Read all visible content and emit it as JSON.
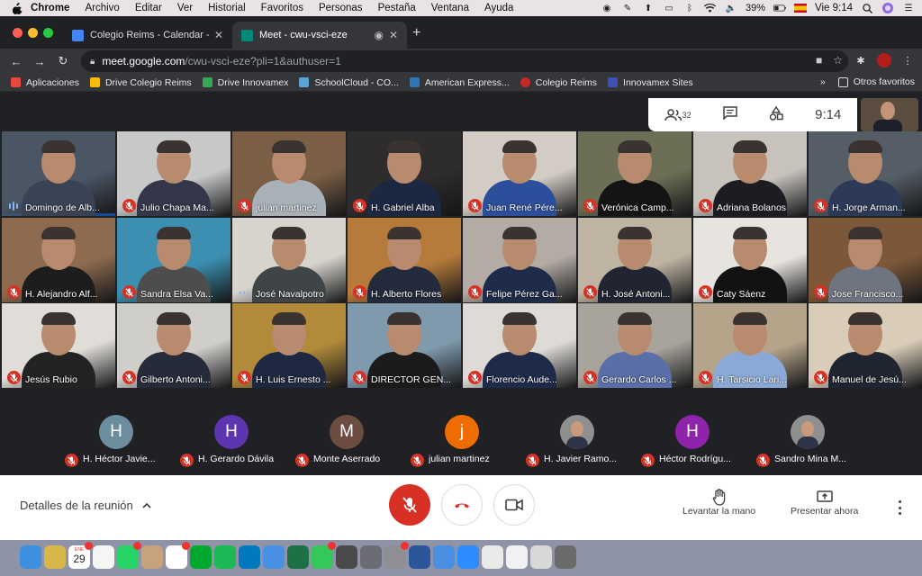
{
  "menubar": {
    "app": "Chrome",
    "items": [
      "Archivo",
      "Editar",
      "Ver",
      "Historial",
      "Favoritos",
      "Personas",
      "Pestaña",
      "Ventana",
      "Ayuda"
    ],
    "battery": "39%",
    "clock": "Vie 9:14"
  },
  "tabs": [
    {
      "title": "Colegio Reims - Calendar - vie",
      "active": false,
      "favicon_color": "#4285f4"
    },
    {
      "title": "Meet - cwu-vsci-eze",
      "active": true,
      "favicon_color": "#00897b"
    }
  ],
  "address": {
    "host": "meet.google.com",
    "path": "/cwu-vsci-eze?pli=1&authuser=1"
  },
  "bookmarks": {
    "items": [
      {
        "label": "Aplicaciones",
        "icon": "apps-grid-icon",
        "color": "#e8453c"
      },
      {
        "label": "Drive Colegio Reims",
        "icon": "drive-icon",
        "color": "#fbbc04"
      },
      {
        "label": "Drive Innovamex",
        "icon": "drive-icon",
        "color": "#34a853"
      },
      {
        "label": "SchoolCloud - CO...",
        "icon": "schoolcloud-icon",
        "color": "#58a6d8"
      },
      {
        "label": "American Express...",
        "icon": "amex-icon",
        "color": "#2e77bb"
      },
      {
        "label": "Colegio Reims",
        "icon": "reims-icon",
        "color": "#c62828"
      },
      {
        "label": "Innovamex Sites",
        "icon": "sites-icon",
        "color": "#3f51b5"
      }
    ],
    "overflow": "»",
    "other": "Otros favoritos"
  },
  "meeting": {
    "participant_count": "32",
    "time": "9:14",
    "grid": [
      {
        "name": "Domingo de Alb...",
        "muted": false,
        "speaking": true,
        "bg": "#4b5665",
        "shirt": "#3a4255"
      },
      {
        "name": "Julio Chapa Ma...",
        "muted": true,
        "bg": "#c7c9c9",
        "shirt": "#34364a"
      },
      {
        "name": "julian martinez",
        "muted": true,
        "bg": "#7a5f45",
        "shirt": "#a8b0b8"
      },
      {
        "name": "H. Gabriel Alba",
        "muted": true,
        "bg": "#2e2c2c",
        "shirt": "#1c2742"
      },
      {
        "name": "Juan René Pére...",
        "muted": true,
        "bg": "#d3ccc4",
        "shirt": "#2b4f9a"
      },
      {
        "name": "Verónica Camp...",
        "muted": true,
        "bg": "#6c6f56",
        "shirt": "#141414"
      },
      {
        "name": "Adriana Bolanos",
        "muted": true,
        "bg": "#c7c2bc",
        "shirt": "#1b1d23"
      },
      {
        "name": "H. Jorge Arman...",
        "muted": true,
        "bg": "#555e66",
        "shirt": "#2c3a58"
      },
      {
        "name": "H. Alejandro Alf...",
        "muted": true,
        "bg": "#8e6b4f",
        "shirt": "#1d1d1d"
      },
      {
        "name": "Sandra Elsa Va...",
        "muted": true,
        "bg": "#3c8fb0",
        "shirt": "#4d4d4d"
      },
      {
        "name": "José Navalpotro",
        "muted": false,
        "speaking": false,
        "bg": "#d7d4cd",
        "shirt": "#3f4447"
      },
      {
        "name": "H. Alberto Flores",
        "muted": true,
        "bg": "#b67b3b",
        "shirt": "#232a3c"
      },
      {
        "name": "Felipe Pérez Ga...",
        "muted": true,
        "bg": "#b3aba4",
        "shirt": "#1f2b4a"
      },
      {
        "name": "H. José Antoni...",
        "muted": true,
        "bg": "#bfb3a1",
        "shirt": "#202531"
      },
      {
        "name": "Caty Sáenz",
        "muted": true,
        "bg": "#e7e3de",
        "shirt": "#121212"
      },
      {
        "name": "Jose Francisco...",
        "muted": true,
        "bg": "#7c5838",
        "shirt": "#6f7580"
      },
      {
        "name": "Jesús Rubio",
        "muted": true,
        "bg": "#e0ddd8",
        "shirt": "#232323"
      },
      {
        "name": "Gilberto Antoni...",
        "muted": true,
        "bg": "#d0cec9",
        "shirt": "#262b3a"
      },
      {
        "name": "H. Luis Ernesto ...",
        "muted": true,
        "bg": "#b18a3a",
        "shirt": "#1e2840"
      },
      {
        "name": "DIRECTOR GEN...",
        "muted": true,
        "bg": "#7f99ad",
        "shirt": "#1b1b1b"
      },
      {
        "name": "Florencio Aude...",
        "muted": true,
        "bg": "#dedbd6",
        "shirt": "#1d2a4a"
      },
      {
        "name": "Gerardo Carlos ...",
        "muted": true,
        "bg": "#a8a39b",
        "shirt": "#5a6fa8"
      },
      {
        "name": "H. Tarsicio Lari...",
        "muted": true,
        "bg": "#b6a48a",
        "shirt": "#8aa9d6"
      },
      {
        "name": "Manuel de Jesú...",
        "muted": true,
        "bg": "#d9cdb9",
        "shirt": "#1f2530"
      }
    ],
    "strip": [
      {
        "name": "H. Héctor Javie...",
        "initial": "H",
        "avatar_color": "#6b8e9e"
      },
      {
        "name": "H. Gerardo Dávila",
        "initial": "H",
        "avatar_color": "#5e35b1"
      },
      {
        "name": "Monte Aserrado",
        "initial": "M",
        "avatar_color": "#6d4c41"
      },
      {
        "name": "julian martinez",
        "initial": "j",
        "avatar_color": "#ef6c00"
      },
      {
        "name": "H. Javier Ramo...",
        "initial": "",
        "avatar_color": "#8f8f8f"
      },
      {
        "name": "Héctor Rodrígu...",
        "initial": "H",
        "avatar_color": "#8e24aa"
      },
      {
        "name": "Sandro Mina M...",
        "initial": "",
        "avatar_color": "#8f8f8f"
      }
    ]
  },
  "controls": {
    "details": "Detalles de la reunión",
    "raise_hand": "Levantar la mano",
    "present": "Presentar ahora"
  },
  "dock": {
    "calendar_date": "29",
    "calendar_month": "ENE",
    "icons": [
      "finder-icon",
      "notes-icon",
      "calendar-icon",
      "reminders-icon",
      "whatsapp-icon",
      "contacts-icon",
      "chrome-icon",
      "evernote-icon",
      "spotify-icon",
      "trello-icon",
      "keynote-icon",
      "excel-icon",
      "facetime-icon",
      "affinity-icon",
      "launchpad-icon",
      "settings-icon",
      "word-icon",
      "mail-icon",
      "zoom-icon",
      "preview-icon",
      "files-icon",
      "photos-icon",
      "trash-icon"
    ]
  }
}
